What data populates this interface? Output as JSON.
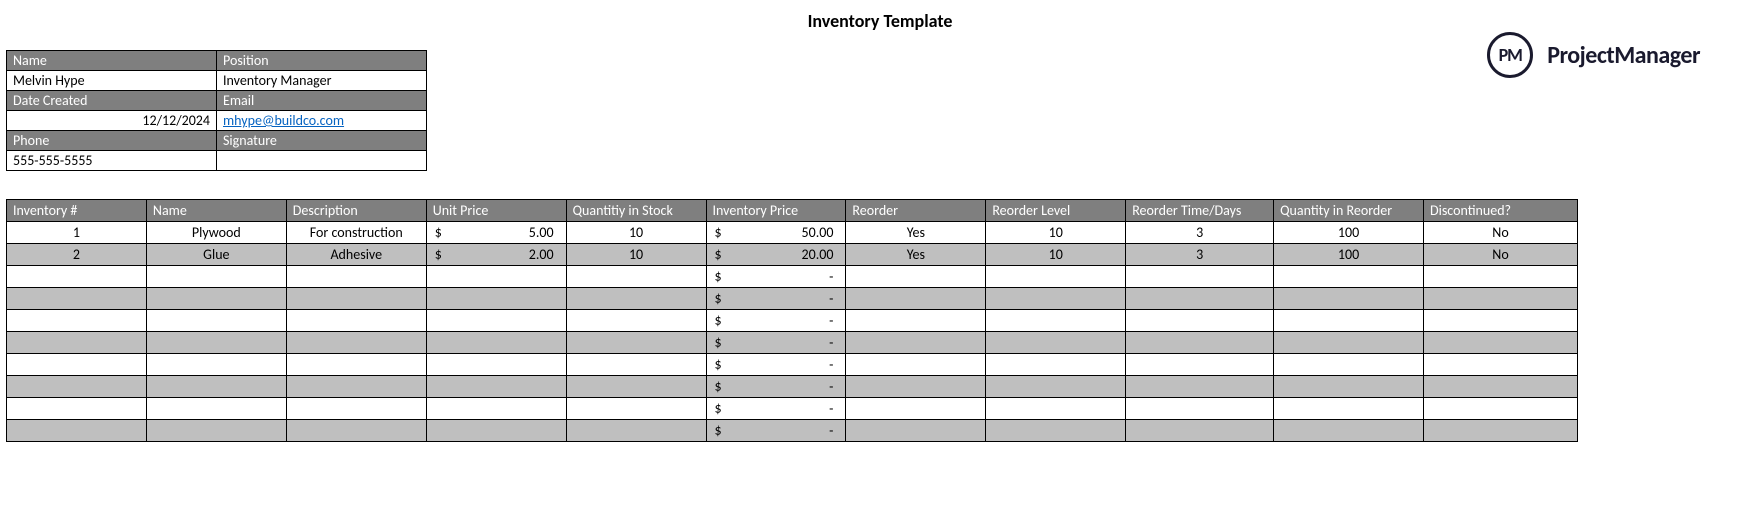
{
  "title": "Inventory Template",
  "brand": {
    "badge": "PM",
    "name": "ProjectManager"
  },
  "info": {
    "labels": {
      "name": "Name",
      "position": "Position",
      "date_created": "Date Created",
      "email": "Email",
      "phone": "Phone",
      "signature": "Signature"
    },
    "values": {
      "name": "Melvin Hype",
      "position": "Inventory Manager",
      "date_created": "12/12/2024",
      "email": "mhype@buildco.com",
      "phone": "555-555-5555",
      "signature": ""
    }
  },
  "columns": [
    "Inventory #",
    "Name",
    "Description",
    "Unit Price",
    "Quantitiy in Stock",
    "Inventory Price",
    "Reorder",
    "Reorder Level",
    "Reorder Time/Days",
    "Quantity in Reorder",
    "Discontinued?"
  ],
  "currency_symbol": "$",
  "dash": "-",
  "rows": [
    {
      "inv": "1",
      "name": "Plywood",
      "desc": "For construction",
      "unit_price": "5.00",
      "qty": "10",
      "inv_price": "50.00",
      "reorder": "Yes",
      "rlevel": "10",
      "rtime": "3",
      "qre": "100",
      "disc": "No"
    },
    {
      "inv": "2",
      "name": "Glue",
      "desc": "Adhesive",
      "unit_price": "2.00",
      "qty": "10",
      "inv_price": "20.00",
      "reorder": "Yes",
      "rlevel": "10",
      "rtime": "3",
      "qre": "100",
      "disc": "No"
    },
    {
      "empty": true
    },
    {
      "empty": true
    },
    {
      "empty": true
    },
    {
      "empty": true
    },
    {
      "empty": true
    },
    {
      "empty": true
    },
    {
      "empty": true
    },
    {
      "empty": true
    }
  ]
}
